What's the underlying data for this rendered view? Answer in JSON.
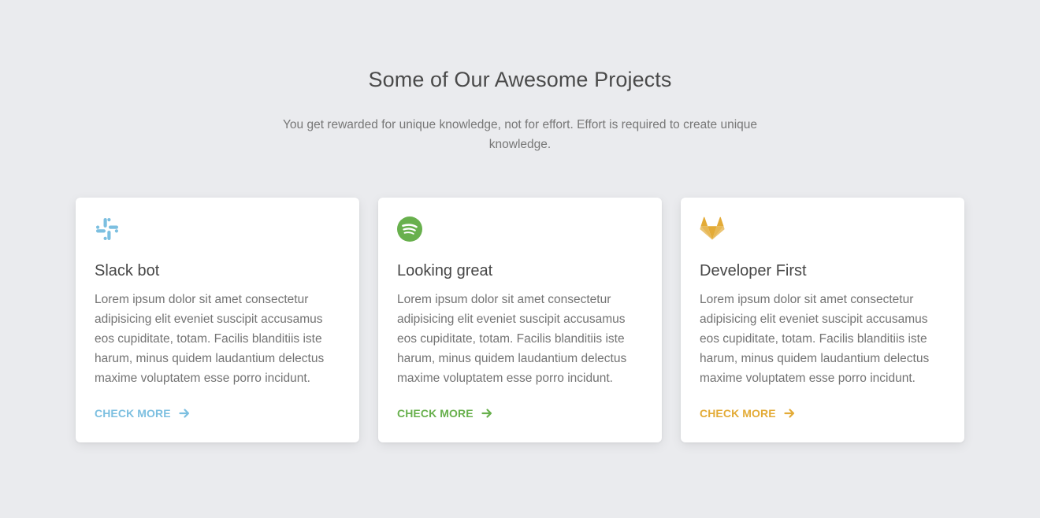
{
  "header": {
    "title": "Some of Our Awesome Projects",
    "subtitle": "You get rewarded for unique knowledge, not for effort. Effort is required to create unique knowledge."
  },
  "cards": [
    {
      "icon": "slack-icon",
      "accent": "#7cbfe0",
      "title": "Slack bot",
      "text": "Lorem ipsum dolor sit amet consectetur adipisicing elit eveniet suscipit accusamus eos cupiditate, totam. Facilis blanditiis iste harum, minus quidem laudantium delectus maxime voluptatem esse porro incidunt.",
      "link_label": "CHECK MORE"
    },
    {
      "icon": "spotify-icon",
      "accent": "#68b04d",
      "title": "Looking great",
      "text": "Lorem ipsum dolor sit amet consectetur adipisicing elit eveniet suscipit accusamus eos cupiditate, totam. Facilis blanditiis iste harum, minus quidem laudantium delectus maxime voluptatem esse porro incidunt.",
      "link_label": "CHECK MORE"
    },
    {
      "icon": "gitlab-icon",
      "accent": "#e3ab37",
      "title": "Developer First",
      "text": "Lorem ipsum dolor sit amet consectetur adipisicing elit eveniet suscipit accusamus eos cupiditate, totam. Facilis blanditiis iste harum, minus quidem laudantium delectus maxime voluptatem esse porro incidunt.",
      "link_label": "CHECK MORE"
    }
  ]
}
